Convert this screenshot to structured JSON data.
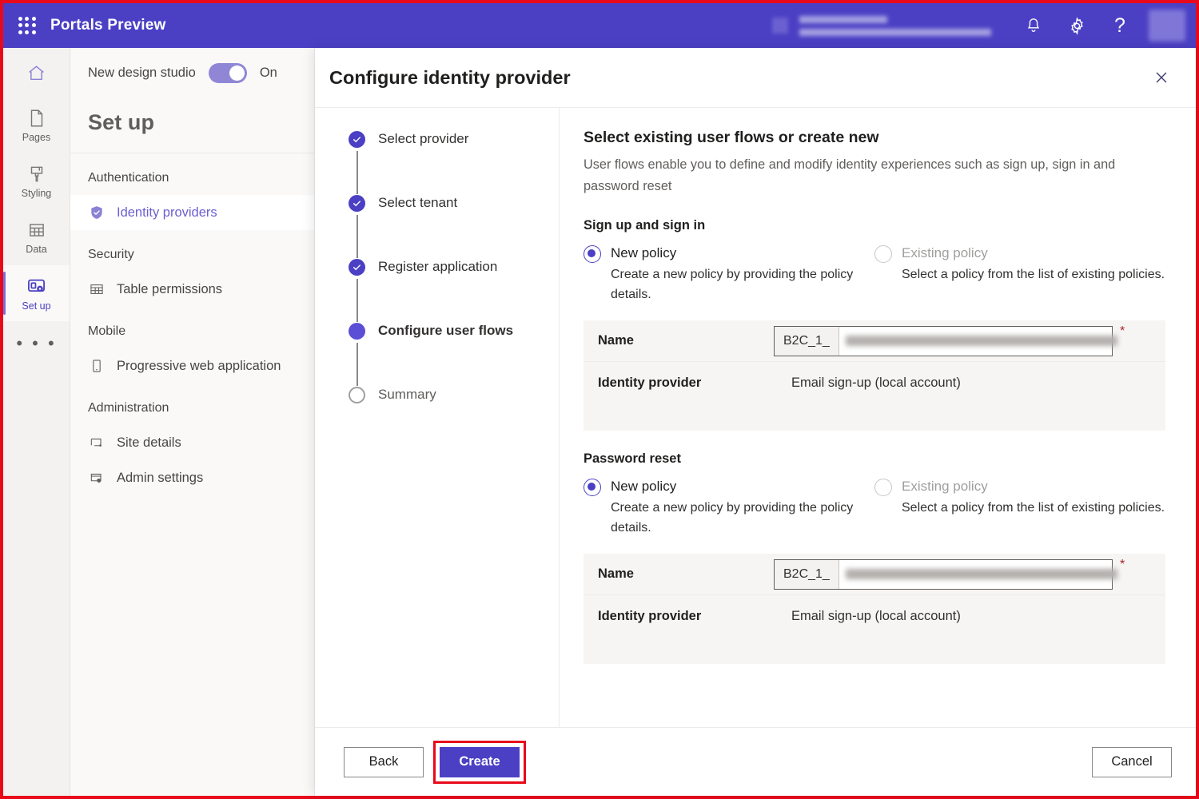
{
  "topbar": {
    "app_launcher_icon": "waffle-grid-icon",
    "title": "Portals Preview",
    "notifications_icon": "bell-icon",
    "settings_icon": "gear-icon",
    "help_icon": "question-mark-icon",
    "help_label": "?",
    "avatar_icon": "avatar-icon",
    "accent_color": "#4b40c4"
  },
  "rail": {
    "home_icon": "home-icon",
    "items": [
      {
        "label": "Pages",
        "icon": "page-icon",
        "active": false
      },
      {
        "label": "Styling",
        "icon": "paint-brush-icon",
        "active": false
      },
      {
        "label": "Data",
        "icon": "table-icon",
        "active": false
      },
      {
        "label": "Set up",
        "icon": "setup-gear-icon",
        "active": true
      }
    ],
    "overflow_label": "• • •"
  },
  "setup_nav": {
    "new_design_studio_label": "New design studio",
    "toggle_state": "On",
    "heading": "Set up",
    "groups": [
      {
        "label": "Authentication",
        "items": [
          {
            "label": "Identity providers",
            "icon": "shield-check-icon",
            "selected": true
          }
        ]
      },
      {
        "label": "Security",
        "items": [
          {
            "label": "Table permissions",
            "icon": "table-grid-icon",
            "selected": false
          }
        ]
      },
      {
        "label": "Mobile",
        "items": [
          {
            "label": "Progressive web application",
            "icon": "mobile-phone-icon",
            "selected": false
          }
        ]
      },
      {
        "label": "Administration",
        "items": [
          {
            "label": "Site details",
            "icon": "site-edit-icon",
            "selected": false
          },
          {
            "label": "Admin settings",
            "icon": "admin-shield-icon",
            "selected": false
          }
        ]
      }
    ]
  },
  "dialog": {
    "title": "Configure identity provider",
    "close_icon": "close-x-icon",
    "close_label": "✕",
    "steps": [
      {
        "label": "Select provider",
        "state": "done"
      },
      {
        "label": "Select tenant",
        "state": "done"
      },
      {
        "label": "Register application",
        "state": "done"
      },
      {
        "label": "Configure user flows",
        "state": "current"
      },
      {
        "label": "Summary",
        "state": "todo"
      }
    ],
    "pane": {
      "heading": "Select existing user flows or create new",
      "description": "User flows enable you to define and modify identity experiences such as sign up, sign in and password reset",
      "sections": [
        {
          "title": "Sign up and sign in",
          "options": [
            {
              "title": "New policy",
              "desc": "Create a new policy by providing the policy details.",
              "selected": true
            },
            {
              "title": "Existing policy",
              "desc": "Select a policy from the list of existing policies.",
              "selected": false
            }
          ],
          "name_label": "Name",
          "name_prefix": "B2C_1_",
          "name_value": "",
          "name_required_marker": "*",
          "provider_label": "Identity provider",
          "provider_value": "Email sign-up (local account)"
        },
        {
          "title": "Password reset",
          "options": [
            {
              "title": "New policy",
              "desc": "Create a new policy by providing the policy details.",
              "selected": true
            },
            {
              "title": "Existing policy",
              "desc": "Select a policy from the list of existing policies.",
              "selected": false
            }
          ],
          "name_label": "Name",
          "name_prefix": "B2C_1_",
          "name_value": "",
          "name_required_marker": "*",
          "provider_label": "Identity provider",
          "provider_value": "Email sign-up (local account)"
        }
      ]
    },
    "footer": {
      "back_label": "Back",
      "create_label": "Create",
      "cancel_label": "Cancel",
      "highlighted_button": "Create"
    }
  },
  "annotation": {
    "frame_color": "#e8091b",
    "highlight_color": "#e8091b"
  }
}
